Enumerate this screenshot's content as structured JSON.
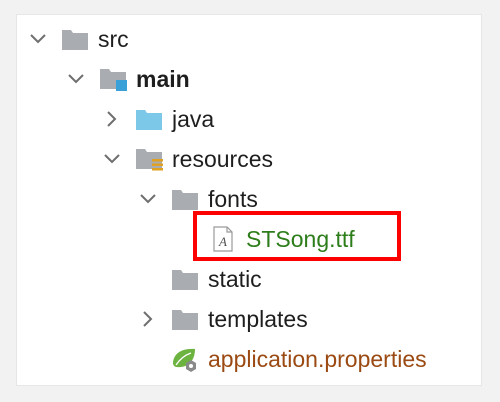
{
  "tree": {
    "nodes": [
      {
        "label": "src",
        "expanded": true,
        "icon": "folder-icon"
      },
      {
        "label": "main",
        "expanded": true,
        "icon": "source-root-folder-icon"
      },
      {
        "label": "java",
        "expanded": false,
        "icon": "java-source-folder-icon"
      },
      {
        "label": "resources",
        "expanded": true,
        "icon": "resources-folder-icon"
      },
      {
        "label": "fonts",
        "expanded": true,
        "icon": "folder-icon"
      },
      {
        "label": "STSong.ttf",
        "icon": "font-file-icon",
        "highlighted": true
      },
      {
        "label": "static",
        "icon": "folder-icon"
      },
      {
        "label": "templates",
        "expanded": false,
        "icon": "folder-icon"
      },
      {
        "label": "application.properties",
        "icon": "spring-properties-icon"
      }
    ]
  },
  "colors": {
    "folder": "#a9adb2",
    "java_folder": "#7cc8e8",
    "file_green": "#2e7d1b",
    "file_brown": "#9a4a12",
    "highlight": "#ff0000"
  }
}
